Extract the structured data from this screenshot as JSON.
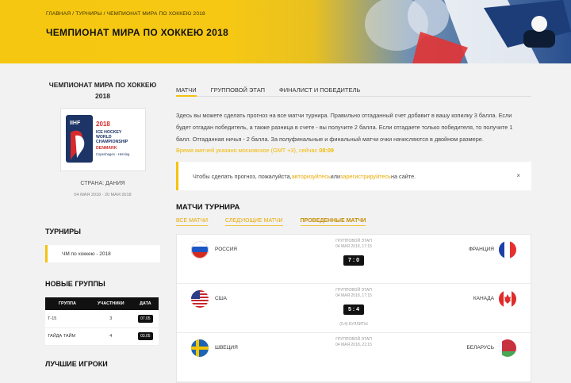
{
  "breadcrumbs": [
    "Главная",
    "/",
    "Турниры",
    "/",
    "Чемпионат мира по хоккею 2018"
  ],
  "page_title": "ЧЕМПИОНАТ МИРА ПО ХОККЕЮ 2018",
  "sidebar": {
    "tournament_title": "ЧЕМПИОНАТ МИРА ПО ХОККЕЮ 2018",
    "logo": {
      "ihf": "IIHF",
      "year": "2018",
      "line1": "ICE HOCKEY",
      "line2": "WORLD",
      "line3": "CHAMPIONSHIP",
      "country": "DENMARK",
      "cities": "Copenhagen - Herning"
    },
    "country": "Страна: Дания",
    "dates": "04 мая 2018 - 20 мая 2018",
    "tournaments_heading": "ТУРНИРЫ",
    "tournament_item": "ЧМ по хоккею - 2018",
    "groups_heading": "НОВЫЕ ГРУППЫ",
    "groups_table": {
      "headers": [
        "Группа",
        "Участники",
        "Дата"
      ],
      "rows": [
        {
          "name": "Т-15",
          "members": "3",
          "date": "07.05"
        },
        {
          "name": "Тайда Тайм",
          "members": "4",
          "date": "03.05"
        }
      ]
    },
    "cut_heading": "ЛУЧШИЕ ИГРОКИ"
  },
  "tabs": [
    {
      "label": "МАТЧИ",
      "active": true
    },
    {
      "label": "ГРУППОВОЙ ЭТАП",
      "active": false
    },
    {
      "label": "ФИНАЛИСТ И ПОБЕДИТЕЛЬ",
      "active": false
    }
  ],
  "intro": "Здесь вы можете сделать прогноз на все матчи турнира. Правильно отгаданный счет добавит в вашу копилку 3 балла. Если будет отгадан победитель, а также разница в счете - вы получите 2 балла. Если отгадаете только победителя, то получите 1 балл. Отгаданная ничья - 2 балла. За полуфинальные и финальный матчи очки начисляются в двойном размере.",
  "timezone": {
    "text": "Время матчей указано московское (GMT +3), сейчас",
    "time": "08:09"
  },
  "notice": {
    "before": "Чтобы сделать прогноз, пожалуйста, ",
    "login": "авторизуйтесь",
    "or": " или ",
    "register": "зарегистрируйтесь",
    "after": " на сайте.",
    "close": "×"
  },
  "matches_heading": "МАТЧИ ТУРНИРА",
  "subtabs": [
    {
      "label": "ВСЕ МАТЧИ",
      "active": false
    },
    {
      "label": "СЛЕДУЮЩИЕ МАТЧИ",
      "active": false
    },
    {
      "label": "ПРОВЕДЕННЫЕ МАТЧИ",
      "active": true
    }
  ],
  "matches": [
    {
      "home": "РОССИЯ",
      "away": "ФРАНЦИЯ",
      "stage": "Групповой этап",
      "date": "04 мая 2018, 17:15",
      "score": "7 : 0",
      "note": "",
      "home_flag": "russia",
      "away_flag": "france"
    },
    {
      "home": "США",
      "away": "КАНАДА",
      "stage": "Групповой этап",
      "date": "04 мая 2018, 17:15",
      "score": "5 : 4",
      "note": "(5:4) буллиты",
      "home_flag": "usa",
      "away_flag": "canada"
    },
    {
      "home": "ШВЕЦИЯ",
      "away": "БЕЛАРУСЬ",
      "stage": "Групповой этап",
      "date": "04 мая 2018, 21:15",
      "score": "",
      "note": "",
      "home_flag": "sweden",
      "away_flag": "belarus"
    }
  ],
  "colors": {
    "accent": "#f5c20f",
    "link": "#e8a900",
    "dark": "#111111"
  }
}
